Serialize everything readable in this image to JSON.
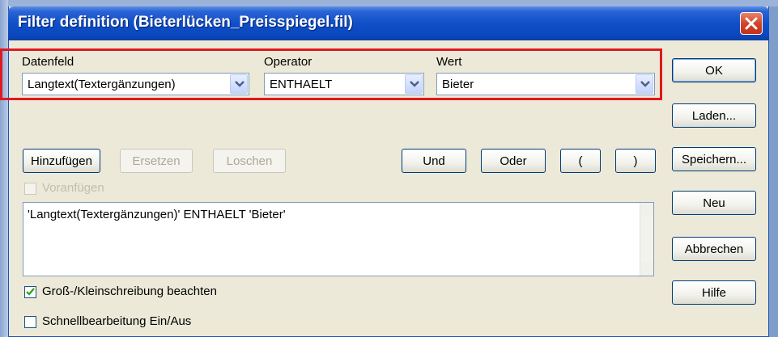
{
  "window": {
    "title": "Filter definition (Bieterlücken_Preisspiegel.fil)"
  },
  "fields": {
    "datenfeld_label": "Datenfeld",
    "datenfeld_value": "Langtext(Textergänzungen)",
    "operator_label": "Operator",
    "operator_value": "ENTHAELT",
    "wert_label": "Wert",
    "wert_value": "Bieter"
  },
  "buttons": {
    "hinzufuegen": "Hinzufügen",
    "ersetzen": "Ersetzen",
    "loeschen": "Loschen",
    "und": "Und",
    "oder": "Oder",
    "paren_open": "(",
    "paren_close": ")"
  },
  "side_buttons": {
    "ok": "OK",
    "laden": "Laden...",
    "speichern": "Speichern...",
    "neu": "Neu",
    "abbrechen": "Abbrechen",
    "hilfe": "Hilfe"
  },
  "voranfuegen": {
    "label": "Voranfügen",
    "checked": false,
    "enabled": false
  },
  "expression": "'Langtext(Textergänzungen)' ENTHAELT 'Bieter'",
  "options": {
    "case_label": "Groß-/Kleinschreibung beachten",
    "case_checked": true,
    "quickedit_label": "Schnellbearbeitung Ein/Aus",
    "quickedit_checked": false
  },
  "colors": {
    "titlebar": "#0b47bd",
    "highlight": "#e0191e",
    "dialog_bg": "#ece9d8"
  }
}
